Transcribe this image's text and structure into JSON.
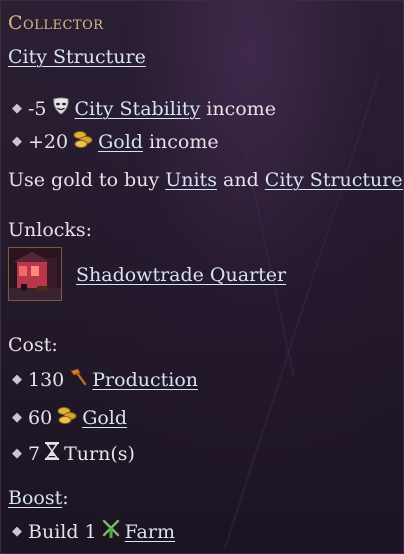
{
  "tooltip": {
    "title": "Collector",
    "category": "City Structure",
    "effects": [
      {
        "amount": "-5",
        "icon": "stability-mask-icon",
        "link": "City Stability",
        "suffix": "income"
      },
      {
        "amount": "+20",
        "icon": "gold-coins-icon",
        "link": "Gold",
        "suffix": "income"
      }
    ],
    "description": {
      "prefix": "Use gold to buy",
      "link1": "Units",
      "middle": "and",
      "link2": "City Structures"
    },
    "unlocks": {
      "heading": "Unlocks:",
      "item_label": "Shadowtrade Quarter"
    },
    "cost": {
      "heading": "Cost:",
      "items": [
        {
          "amount": "130",
          "icon": "hammer-icon",
          "label": "Production"
        },
        {
          "amount": "60",
          "icon": "gold-coins-icon",
          "label": "Gold"
        },
        {
          "amount": "7",
          "icon": "hourglass-icon",
          "label": "Turn(s)"
        }
      ]
    },
    "boost": {
      "heading": "Boost",
      "colon": ":",
      "prefix": "Build 1",
      "icon": "farm-windmill-icon",
      "link": "Farm"
    }
  },
  "colors": {
    "title": "#d7b98a",
    "link": "#d6e3f7",
    "text": "#e7e1ea",
    "gold": "#e2b23a",
    "farm_green": "#6fc15a"
  }
}
